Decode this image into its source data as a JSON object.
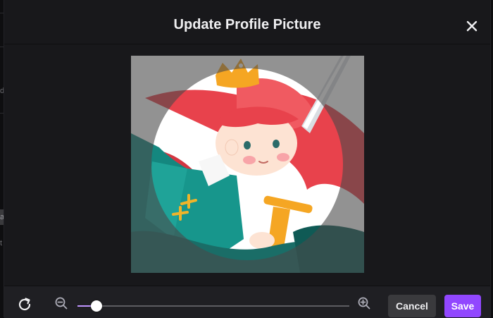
{
  "background": {
    "fragments": [
      "d",
      "a",
      "t"
    ]
  },
  "modal": {
    "title": "Update Profile Picture",
    "close_icon": "close-icon"
  },
  "cropper": {
    "image_description_icon": "profile-avatar-image",
    "mask_shape": "circle"
  },
  "toolbar": {
    "rotate_icon": "rotate-icon",
    "zoom_out_icon": "zoom-out-icon",
    "zoom_in_icon": "zoom-in-icon",
    "zoom_level": 0.07,
    "cancel_label": "Cancel",
    "save_label": "Save"
  },
  "colors": {
    "modal_bg": "#18181b",
    "accent": "#9147ff",
    "cancel_bg": "#3a3a3d",
    "slider_thumb": "#ffffff"
  }
}
